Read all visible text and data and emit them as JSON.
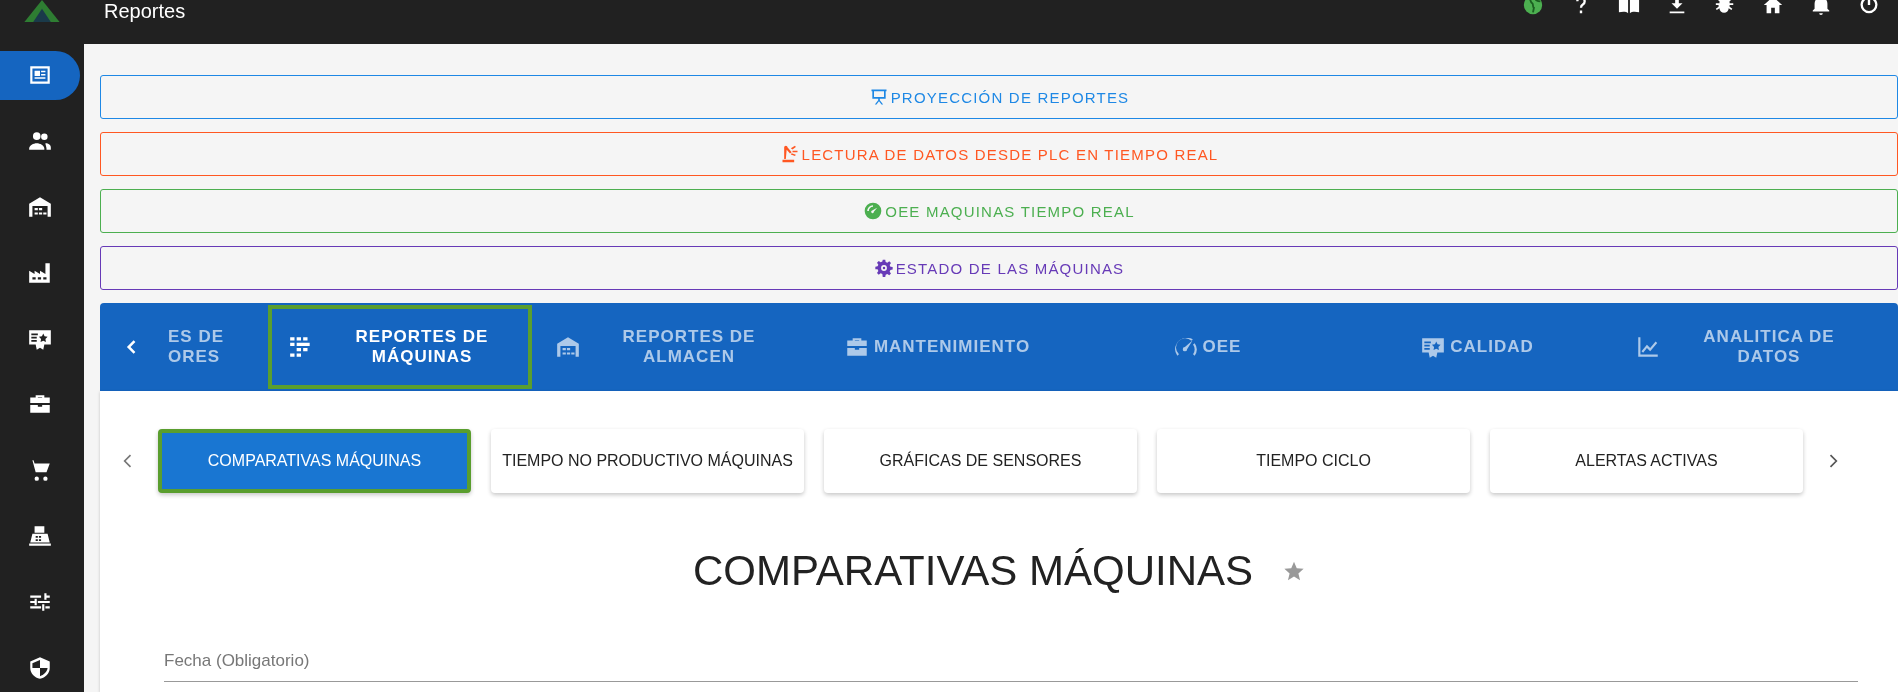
{
  "app_bar": {
    "title": "Reportes"
  },
  "sidebar": {
    "items": [
      {
        "selected": true
      },
      {
        "selected": false
      },
      {
        "selected": false
      },
      {
        "selected": false
      },
      {
        "selected": false
      },
      {
        "selected": false
      },
      {
        "selected": false
      },
      {
        "selected": false
      },
      {
        "selected": false
      },
      {
        "selected": false
      }
    ]
  },
  "quick_links": [
    {
      "label": "PROYECCIÓN DE REPORTES",
      "color": "#1e88e5",
      "kind": "projector"
    },
    {
      "label": "LECTURA DE DATOS DESDE PLC EN TIEMPO REAL",
      "color": "#ff5722",
      "kind": "robot"
    },
    {
      "label": "OEE MAQUINAS TIEMPO REAL",
      "color": "#4caf50",
      "kind": "gauge"
    },
    {
      "label": "ESTADO DE LAS MÁQUINAS",
      "color": "#673ab7",
      "kind": "gear"
    }
  ],
  "main_tabs": [
    {
      "label": "ES DE ORES",
      "selected": false,
      "kind": "none"
    },
    {
      "label": "REPORTES DE MÁQUINAS",
      "selected": true,
      "kind": "machine"
    },
    {
      "label": "REPORTES DE ALMACEN",
      "selected": false,
      "kind": "warehouse"
    },
    {
      "label": "MANTENIMIENTO",
      "selected": false,
      "kind": "toolbox"
    },
    {
      "label": "OEE",
      "selected": false,
      "kind": "speed"
    },
    {
      "label": "CALIDAD",
      "selected": false,
      "kind": "quality"
    },
    {
      "label": "ANALITICA DE DATOS",
      "selected": false,
      "kind": "chart"
    }
  ],
  "sub_tabs": [
    {
      "label": "COMPARATIVAS MÁQUINAS",
      "selected": true
    },
    {
      "label": "TIEMPO NO PRODUCTIVO MÁQUINAS",
      "selected": false
    },
    {
      "label": "GRÁFICAS DE SENSORES",
      "selected": false
    },
    {
      "label": "TIEMPO CICLO",
      "selected": false
    },
    {
      "label": "ALERTAS ACTIVAS",
      "selected": false
    }
  ],
  "page_title": "COMPARATIVAS MÁQUINAS",
  "date_field": {
    "placeholder": "Fecha (Obligatorio)"
  }
}
